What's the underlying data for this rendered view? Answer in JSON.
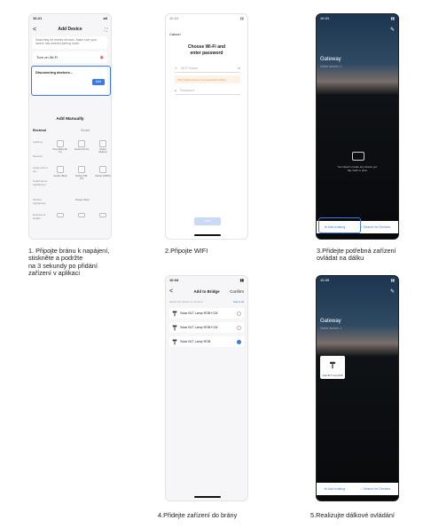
{
  "screen1": {
    "time": "10:21",
    "signal": "all",
    "header_back": "<",
    "title": "Add Device",
    "scan_icon": "scan-icon",
    "notice": "Searching for nearby devices. Make sure your device has entered pairing mode.",
    "wifi_row": "Turn on Wi-Fi",
    "discovering": "Discovering devices...",
    "add_button": "Add",
    "add_manually": "Add Manually",
    "tabs": [
      "Electrical",
      "Socket"
    ],
    "categories": [
      "Lighting",
      "Sensors",
      "Large Home Ap...",
      "Small Home Appliances",
      "Kitchen Appliances",
      "Exercise & Health"
    ],
    "devices": [
      {
        "name": "Plug (BLE+Wi-Fi)"
      },
      {
        "name": "Socket (Wi-Fi)"
      },
      {
        "name": "Socket (Zigbee)"
      },
      {
        "name": "Socket (BLE)"
      },
      {
        "name": "Socket (NB-IoT)"
      },
      {
        "name": "Socket (GPRS)"
      }
    ],
    "power_strip": "Power Strip"
  },
  "screen2": {
    "time": "10:21",
    "cancel": "Cancel",
    "title": "Choose Wi-Fi and enter password",
    "wifi_placeholder": "Wi-Fi Name",
    "warning": "This mobile phone is not connected to Wi-Fi",
    "password_placeholder": "Password",
    "next": "Next"
  },
  "screen3": {
    "gateway": "Gateway",
    "online": "Online devices: 0",
    "empty_line1": "You haven't create any device yet.",
    "empty_line2": "Tap 'Add' to start.",
    "add_existing": "Add existing",
    "search": "Search for Devices"
  },
  "screen4": {
    "time": "10:34",
    "back": "<",
    "title": "Add to Bridge",
    "confirm": "Confirm",
    "hint": "Select the device to connect",
    "select_all": "Select all",
    "lamps": [
      {
        "name": "Solar BLT Lamp RGB+CW",
        "checked": false
      },
      {
        "name": "Solar BLT Lamp RGB+CW",
        "checked": false
      },
      {
        "name": "Solar BLT Lamp RGB",
        "checked": true
      }
    ]
  },
  "screen5": {
    "gateway": "Gateway",
    "online": "Online devices: 1",
    "tile_name": "Solar BLT Lamp RGB",
    "add_existing": "Add existing",
    "search": "Search for Devices"
  },
  "captions": {
    "c1": "1. Připojte bránu k napájení,\nstiskněte a podržte\nna 3 sekundy po přidání\nzařízení v aplikaci",
    "c2": "2.Připojte WIFI",
    "c3": "3.Přidejte potřebná zařízení\novládat na dálku",
    "c4": "4.Přidejte zařízení do brány",
    "c5": "5.Realizujte dálkové ovládání"
  },
  "colors": {
    "accent": "#3a7be8",
    "warning": "#f08a3c"
  }
}
